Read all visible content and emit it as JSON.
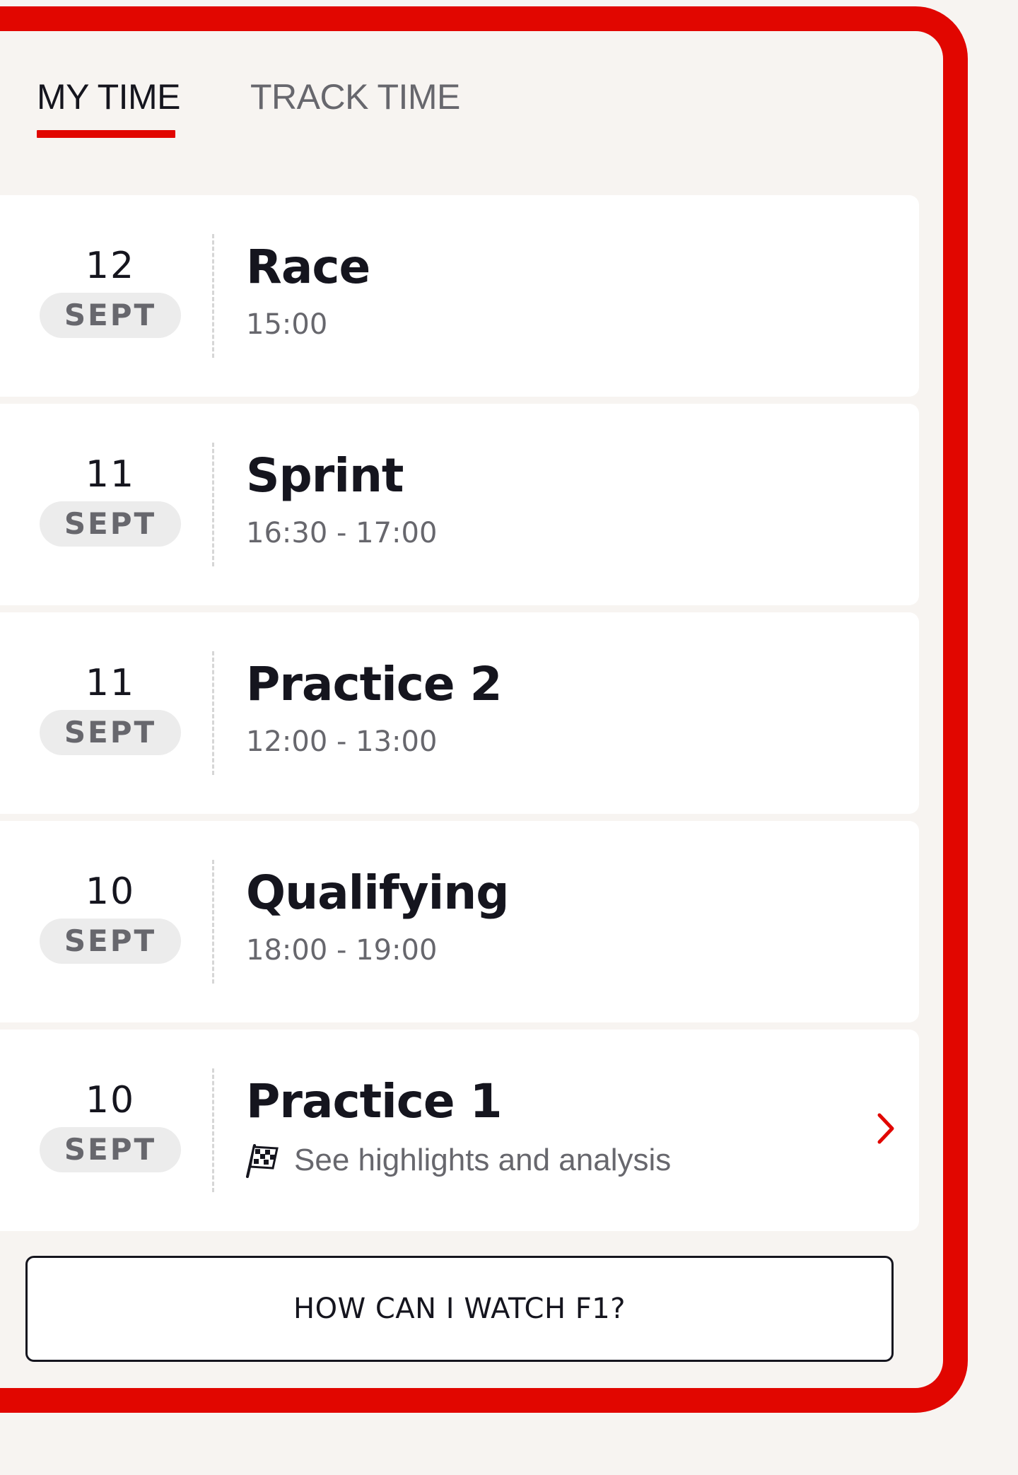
{
  "tabs": {
    "my_time": "MY TIME",
    "track_time": "TRACK TIME",
    "active": "MY TIME"
  },
  "sessions": [
    {
      "day": "12",
      "month": "SEPT",
      "title": "Race",
      "time": "15:00"
    },
    {
      "day": "11",
      "month": "SEPT",
      "title": "Sprint",
      "time": "16:30 - 17:00"
    },
    {
      "day": "11",
      "month": "SEPT",
      "title": "Practice 2",
      "time": "12:00 - 13:00"
    },
    {
      "day": "10",
      "month": "SEPT",
      "title": "Qualifying",
      "time": "18:00 - 19:00"
    },
    {
      "day": "10",
      "month": "SEPT",
      "title": "Practice 1",
      "highlights": "See highlights and analysis",
      "icon": "chequered-flag-icon",
      "action_icon": "chevron-right-icon"
    }
  ],
  "watch_button": {
    "label": "HOW CAN I WATCH F1?"
  },
  "colors": {
    "accent": "#e10600",
    "text_dark": "#15151e",
    "text_muted": "#67676d",
    "background": "#f7f4f1",
    "card": "#ffffff"
  }
}
